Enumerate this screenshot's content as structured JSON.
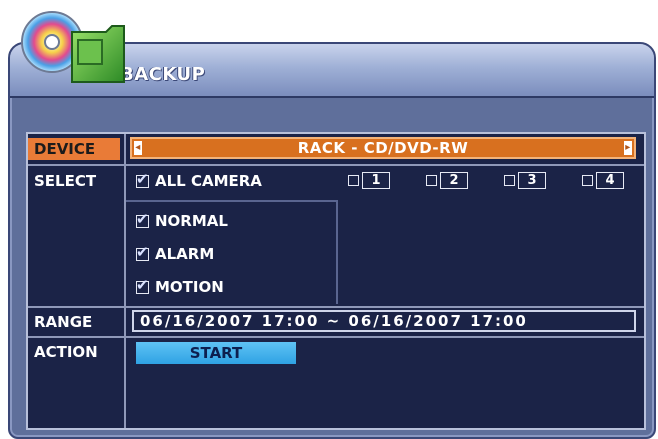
{
  "window": {
    "title": "BACKUP"
  },
  "device": {
    "label": "DEVICE",
    "value": "RACK - CD/DVD-RW",
    "left_arrow": "◂",
    "right_arrow": "▸"
  },
  "select": {
    "label": "SELECT",
    "all_camera": {
      "label": "ALL CAMERA",
      "checked": true
    },
    "cameras": [
      {
        "label": "1",
        "checked": false
      },
      {
        "label": "2",
        "checked": false
      },
      {
        "label": "3",
        "checked": false
      },
      {
        "label": "4",
        "checked": false
      }
    ],
    "types": [
      {
        "label": "NORMAL",
        "checked": true
      },
      {
        "label": "ALARM",
        "checked": true
      },
      {
        "label": "MOTION",
        "checked": true
      }
    ]
  },
  "range": {
    "label": "RANGE",
    "value": "06/16/2007 17:00 ~ 06/16/2007 17:00"
  },
  "action": {
    "label": "ACTION",
    "button": "START"
  },
  "icons": {
    "logo": "cd-folder-backup-icon",
    "check": "check-icon"
  },
  "colors": {
    "panel_bg": "#1b2347",
    "device_accent": "#e97b37",
    "start_button": "#2fa2e4"
  }
}
